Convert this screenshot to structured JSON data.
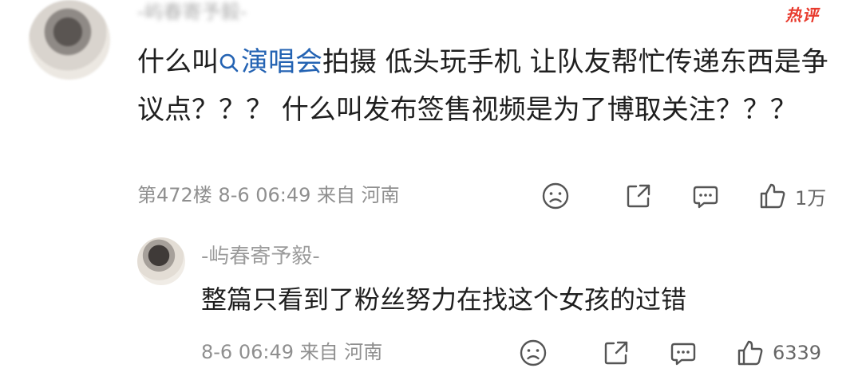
{
  "comment": {
    "author_name": "-屿春寄予毅-",
    "hot_label": "热评",
    "text_before_link": "什么叫",
    "search_link": "演唱会",
    "text_after_link": "拍摄 低头玩手机 让队友帮忙传递东西是争议点？？？ 什么叫发布签售视频是为了博取关注？？？",
    "meta": "第472楼 8-6 06:49 来自 河南",
    "like_count": "1万"
  },
  "reply": {
    "author_name": "-屿春寄予毅-",
    "text": "整篇只看到了粉丝努力在找这个女孩的过错",
    "meta": "8-6 06:49 来自 河南",
    "like_count": "6339"
  },
  "icons": {
    "dislike": "sad-face-icon",
    "share": "share-icon",
    "reply": "comment-bubble-icon",
    "like": "thumbs-up-icon",
    "search": "search-icon"
  },
  "colors": {
    "link": "#2463b3",
    "hot": "#e83a2d",
    "meta": "#8f8f8f"
  }
}
